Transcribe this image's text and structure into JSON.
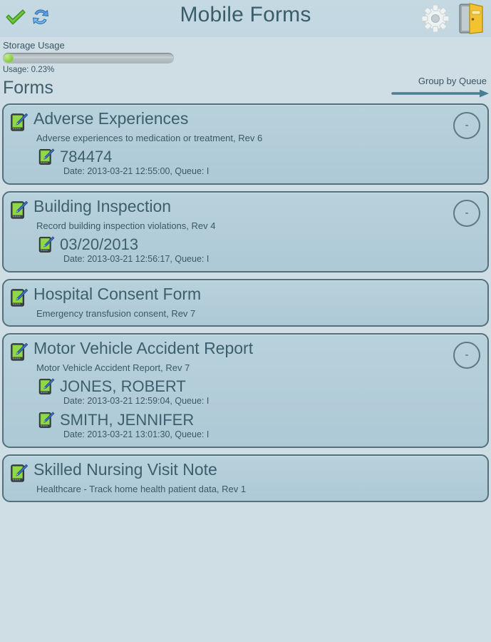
{
  "header": {
    "title": "Mobile Forms",
    "left_icons": [
      {
        "name": "check-icon",
        "label": "Submit / Accept"
      },
      {
        "name": "sync-refresh-icon",
        "label": "Sync"
      }
    ],
    "right_icons": [
      {
        "name": "gear-settings-icon",
        "label": "Settings"
      },
      {
        "name": "exit-door-icon",
        "label": "Exit"
      }
    ]
  },
  "storage": {
    "label": "Storage Usage",
    "usage_text": "Usage: 0.23%",
    "percent": 0.23,
    "fill_color": "#8fd04a"
  },
  "forms_section": {
    "title": "Forms",
    "group_by_label": "Group by Queue",
    "arrow_color": "#4a7f93"
  },
  "collapse_symbol": "-",
  "colors": {
    "page_background": "#cfdde5",
    "header_background": "#c3d8e1",
    "card_background": "#b2cdd8",
    "card_border": "#53707d",
    "title_text": "#3d5e6c",
    "body_text": "#3b5867"
  },
  "cards": [
    {
      "title": "Adverse Experiences",
      "subtitle": "Adverse experiences to medication or treatment, Rev 6",
      "has_collapse": true,
      "entries": [
        {
          "title": "784474",
          "meta": "Date: 2013-03-21 12:55:00, Queue: I"
        }
      ]
    },
    {
      "title": "Building Inspection",
      "subtitle": "Record building inspection violations, Rev 4",
      "has_collapse": true,
      "entries": [
        {
          "title": "03/20/2013",
          "meta": "Date: 2013-03-21 12:56:17, Queue: I"
        }
      ]
    },
    {
      "title": "Hospital Consent Form",
      "subtitle": "Emergency transfusion consent, Rev 7",
      "has_collapse": false,
      "entries": []
    },
    {
      "title": "Motor Vehicle Accident Report",
      "subtitle": "Motor Vehicle Accident Report, Rev 7",
      "has_collapse": true,
      "entries": [
        {
          "title": "JONES, ROBERT",
          "meta": "Date: 2013-03-21 12:59:04, Queue: I"
        },
        {
          "title": "SMITH, JENNIFER",
          "meta": "Date: 2013-03-21 13:01:30, Queue: I"
        }
      ]
    },
    {
      "title": "Skilled Nursing Visit Note",
      "subtitle": "Healthcare - Track home health patient data, Rev 1",
      "has_collapse": false,
      "entries": []
    }
  ]
}
